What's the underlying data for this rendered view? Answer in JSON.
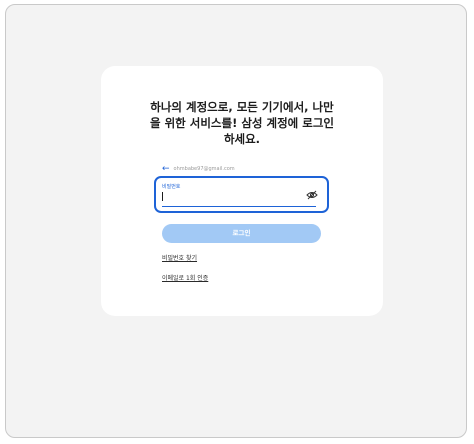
{
  "headline": "하나의 계정으로, 모든 기기에서, 나만\n을 위한 서비스를! 삼성 계정에 로그인\n하세요.",
  "account": {
    "email": "ohmbabe97@gmail.com"
  },
  "password_field": {
    "label": "비밀번호",
    "value": ""
  },
  "buttons": {
    "login": "로그인"
  },
  "links": {
    "find_password": "비밀번호 찾기",
    "email_verify": "이메일로 1회 인증"
  },
  "colors": {
    "accent": "#1e63d7",
    "login_button_disabled": "#a2c9f5",
    "background": "#f3f3f3",
    "card": "#ffffff"
  },
  "icons": {
    "back": "back-arrow-icon",
    "toggle_visibility": "eye-icon"
  }
}
